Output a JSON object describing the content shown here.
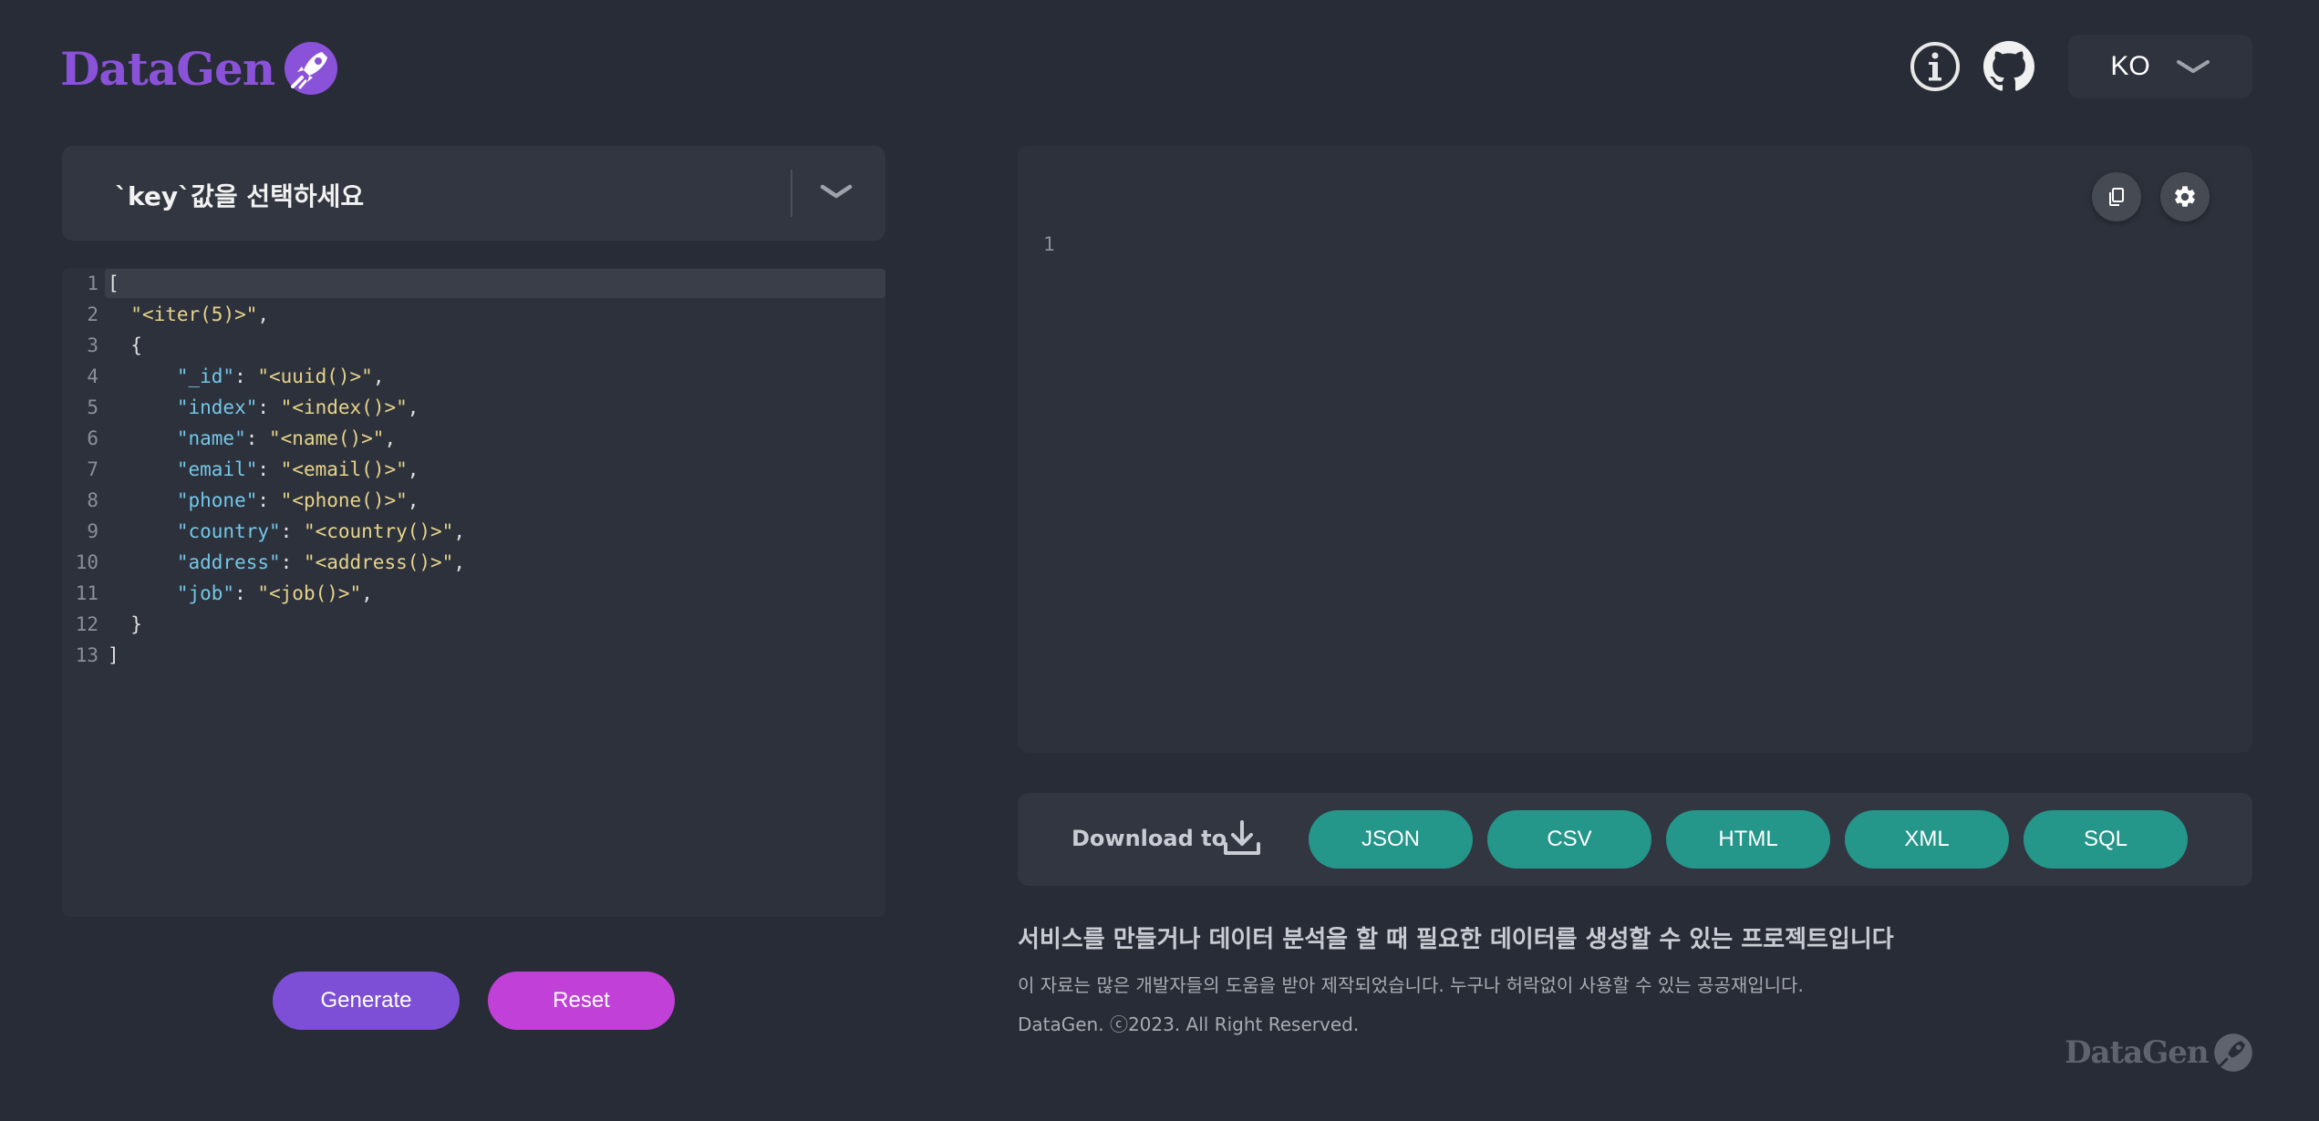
{
  "header": {
    "logo_text": "DataGen",
    "lang": {
      "selected": "KO"
    },
    "icons": [
      "info-icon",
      "github-icon",
      "chevron-down-icon"
    ]
  },
  "left": {
    "key_select": {
      "placeholder": "`key`값을 선택하세요"
    },
    "editor": {
      "lines": [
        {
          "n": "1",
          "indent": "",
          "tokens": [
            {
              "t": "p",
              "v": "["
            }
          ]
        },
        {
          "n": "2",
          "indent": "  ",
          "tokens": [
            {
              "t": "s",
              "v": "\"<iter(5)>\""
            },
            {
              "t": "p",
              "v": ","
            }
          ]
        },
        {
          "n": "3",
          "indent": "  ",
          "tokens": [
            {
              "t": "p",
              "v": "{"
            }
          ]
        },
        {
          "n": "4",
          "indent": "      ",
          "tokens": [
            {
              "t": "k",
              "v": "\"_id\""
            },
            {
              "t": "p",
              "v": ": "
            },
            {
              "t": "s",
              "v": "\"<uuid()>\""
            },
            {
              "t": "p",
              "v": ","
            }
          ]
        },
        {
          "n": "5",
          "indent": "      ",
          "tokens": [
            {
              "t": "k",
              "v": "\"index\""
            },
            {
              "t": "p",
              "v": ": "
            },
            {
              "t": "s",
              "v": "\"<index()>\""
            },
            {
              "t": "p",
              "v": ","
            }
          ]
        },
        {
          "n": "6",
          "indent": "      ",
          "tokens": [
            {
              "t": "k",
              "v": "\"name\""
            },
            {
              "t": "p",
              "v": ": "
            },
            {
              "t": "s",
              "v": "\"<name()>\""
            },
            {
              "t": "p",
              "v": ","
            }
          ]
        },
        {
          "n": "7",
          "indent": "      ",
          "tokens": [
            {
              "t": "k",
              "v": "\"email\""
            },
            {
              "t": "p",
              "v": ": "
            },
            {
              "t": "s",
              "v": "\"<email()>\""
            },
            {
              "t": "p",
              "v": ","
            }
          ]
        },
        {
          "n": "8",
          "indent": "      ",
          "tokens": [
            {
              "t": "k",
              "v": "\"phone\""
            },
            {
              "t": "p",
              "v": ": "
            },
            {
              "t": "s",
              "v": "\"<phone()>\""
            },
            {
              "t": "p",
              "v": ","
            }
          ]
        },
        {
          "n": "9",
          "indent": "      ",
          "tokens": [
            {
              "t": "k",
              "v": "\"country\""
            },
            {
              "t": "p",
              "v": ": "
            },
            {
              "t": "s",
              "v": "\"<country()>\""
            },
            {
              "t": "p",
              "v": ","
            }
          ]
        },
        {
          "n": "10",
          "indent": "      ",
          "tokens": [
            {
              "t": "k",
              "v": "\"address\""
            },
            {
              "t": "p",
              "v": ": "
            },
            {
              "t": "s",
              "v": "\"<address()>\""
            },
            {
              "t": "p",
              "v": ","
            }
          ]
        },
        {
          "n": "11",
          "indent": "      ",
          "tokens": [
            {
              "t": "k",
              "v": "\"job\""
            },
            {
              "t": "p",
              "v": ": "
            },
            {
              "t": "s",
              "v": "\"<job()>\""
            },
            {
              "t": "p",
              "v": ","
            }
          ]
        },
        {
          "n": "12",
          "indent": "  ",
          "tokens": [
            {
              "t": "p",
              "v": "}"
            }
          ]
        },
        {
          "n": "13",
          "indent": "",
          "tokens": [
            {
              "t": "p",
              "v": "]"
            }
          ]
        }
      ]
    },
    "buttons": {
      "generate": "Generate",
      "reset": "Reset"
    }
  },
  "right": {
    "output": {
      "line_number": "1"
    },
    "download": {
      "label": "Download to",
      "formats": [
        "JSON",
        "CSV",
        "HTML",
        "XML",
        "SQL"
      ]
    },
    "description": {
      "title": "서비스를 만들거나 데이터 분석을 할 때 필요한 데이터를 생성할 수 있는 프로젝트입니다",
      "subtitle": "이 자료는 많은 개발자들의 도움을 받아 제작되었습니다. 누구나 허락없이 사용할 수 있는 공공재입니다.",
      "copyright": "DataGen. ⓒ2023. All Right Reserved."
    },
    "footer_logo_text": "DataGen"
  },
  "colors": {
    "background": "#282c36",
    "panel": "#2d313b",
    "brand_purple": "#8a52d9",
    "generate": "#7d4fd6",
    "reset": "#c140d8",
    "format_button": "#25968a"
  }
}
